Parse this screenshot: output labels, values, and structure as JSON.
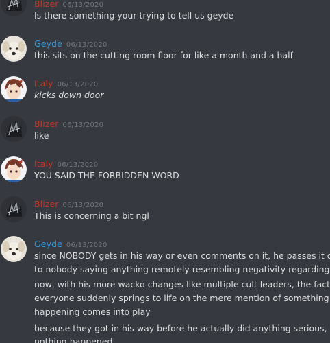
{
  "colors": {
    "background": "#36393f",
    "text": "#dcddde",
    "timestamp": "#72767d",
    "blizer": "#c0392b",
    "geyde": "#3498db",
    "italy": "#c0392b"
  },
  "messages": [
    {
      "author": "Blizer",
      "timestamp": "06/13/2020",
      "avatar": "wolf-avatar",
      "lines": [
        "Is there something your trying to tell us geyde"
      ]
    },
    {
      "author": "Geyde",
      "timestamp": "06/13/2020",
      "avatar": "dog-avatar",
      "lines": [
        "this sits on the cutting room floor for like a month and a half"
      ]
    },
    {
      "author": "Italy",
      "timestamp": "06/13/2020",
      "avatar": "anime-avatar",
      "lines": [
        "kicks down door"
      ]
    },
    {
      "author": "Blizer",
      "timestamp": "06/13/2020",
      "avatar": "wolf-avatar",
      "lines": [
        "like"
      ]
    },
    {
      "author": "Italy",
      "timestamp": "06/13/2020",
      "avatar": "anime-avatar",
      "lines": [
        "YOU SAID THE FORBIDDEN WORD"
      ]
    },
    {
      "author": "Blizer",
      "timestamp": "06/13/2020",
      "avatar": "wolf-avatar",
      "lines": [
        "This is concerning a bit ngl"
      ]
    },
    {
      "author": "Geyde",
      "timestamp": "06/13/2020",
      "avatar": "dog-avatar",
      "lines": [
        "since NOBODY gets in his way or even comments on it, he passes it due",
        "to nobody saying anything remotely resembling negativity regarding it",
        "now, with his more wacko changes like multiple cult leaders, the fact that",
        "everyone suddenly springs to life on the mere mention of something big",
        "happening comes into play",
        "because they got in his way before he actually did anything serious,",
        "nothing happened"
      ]
    }
  ]
}
